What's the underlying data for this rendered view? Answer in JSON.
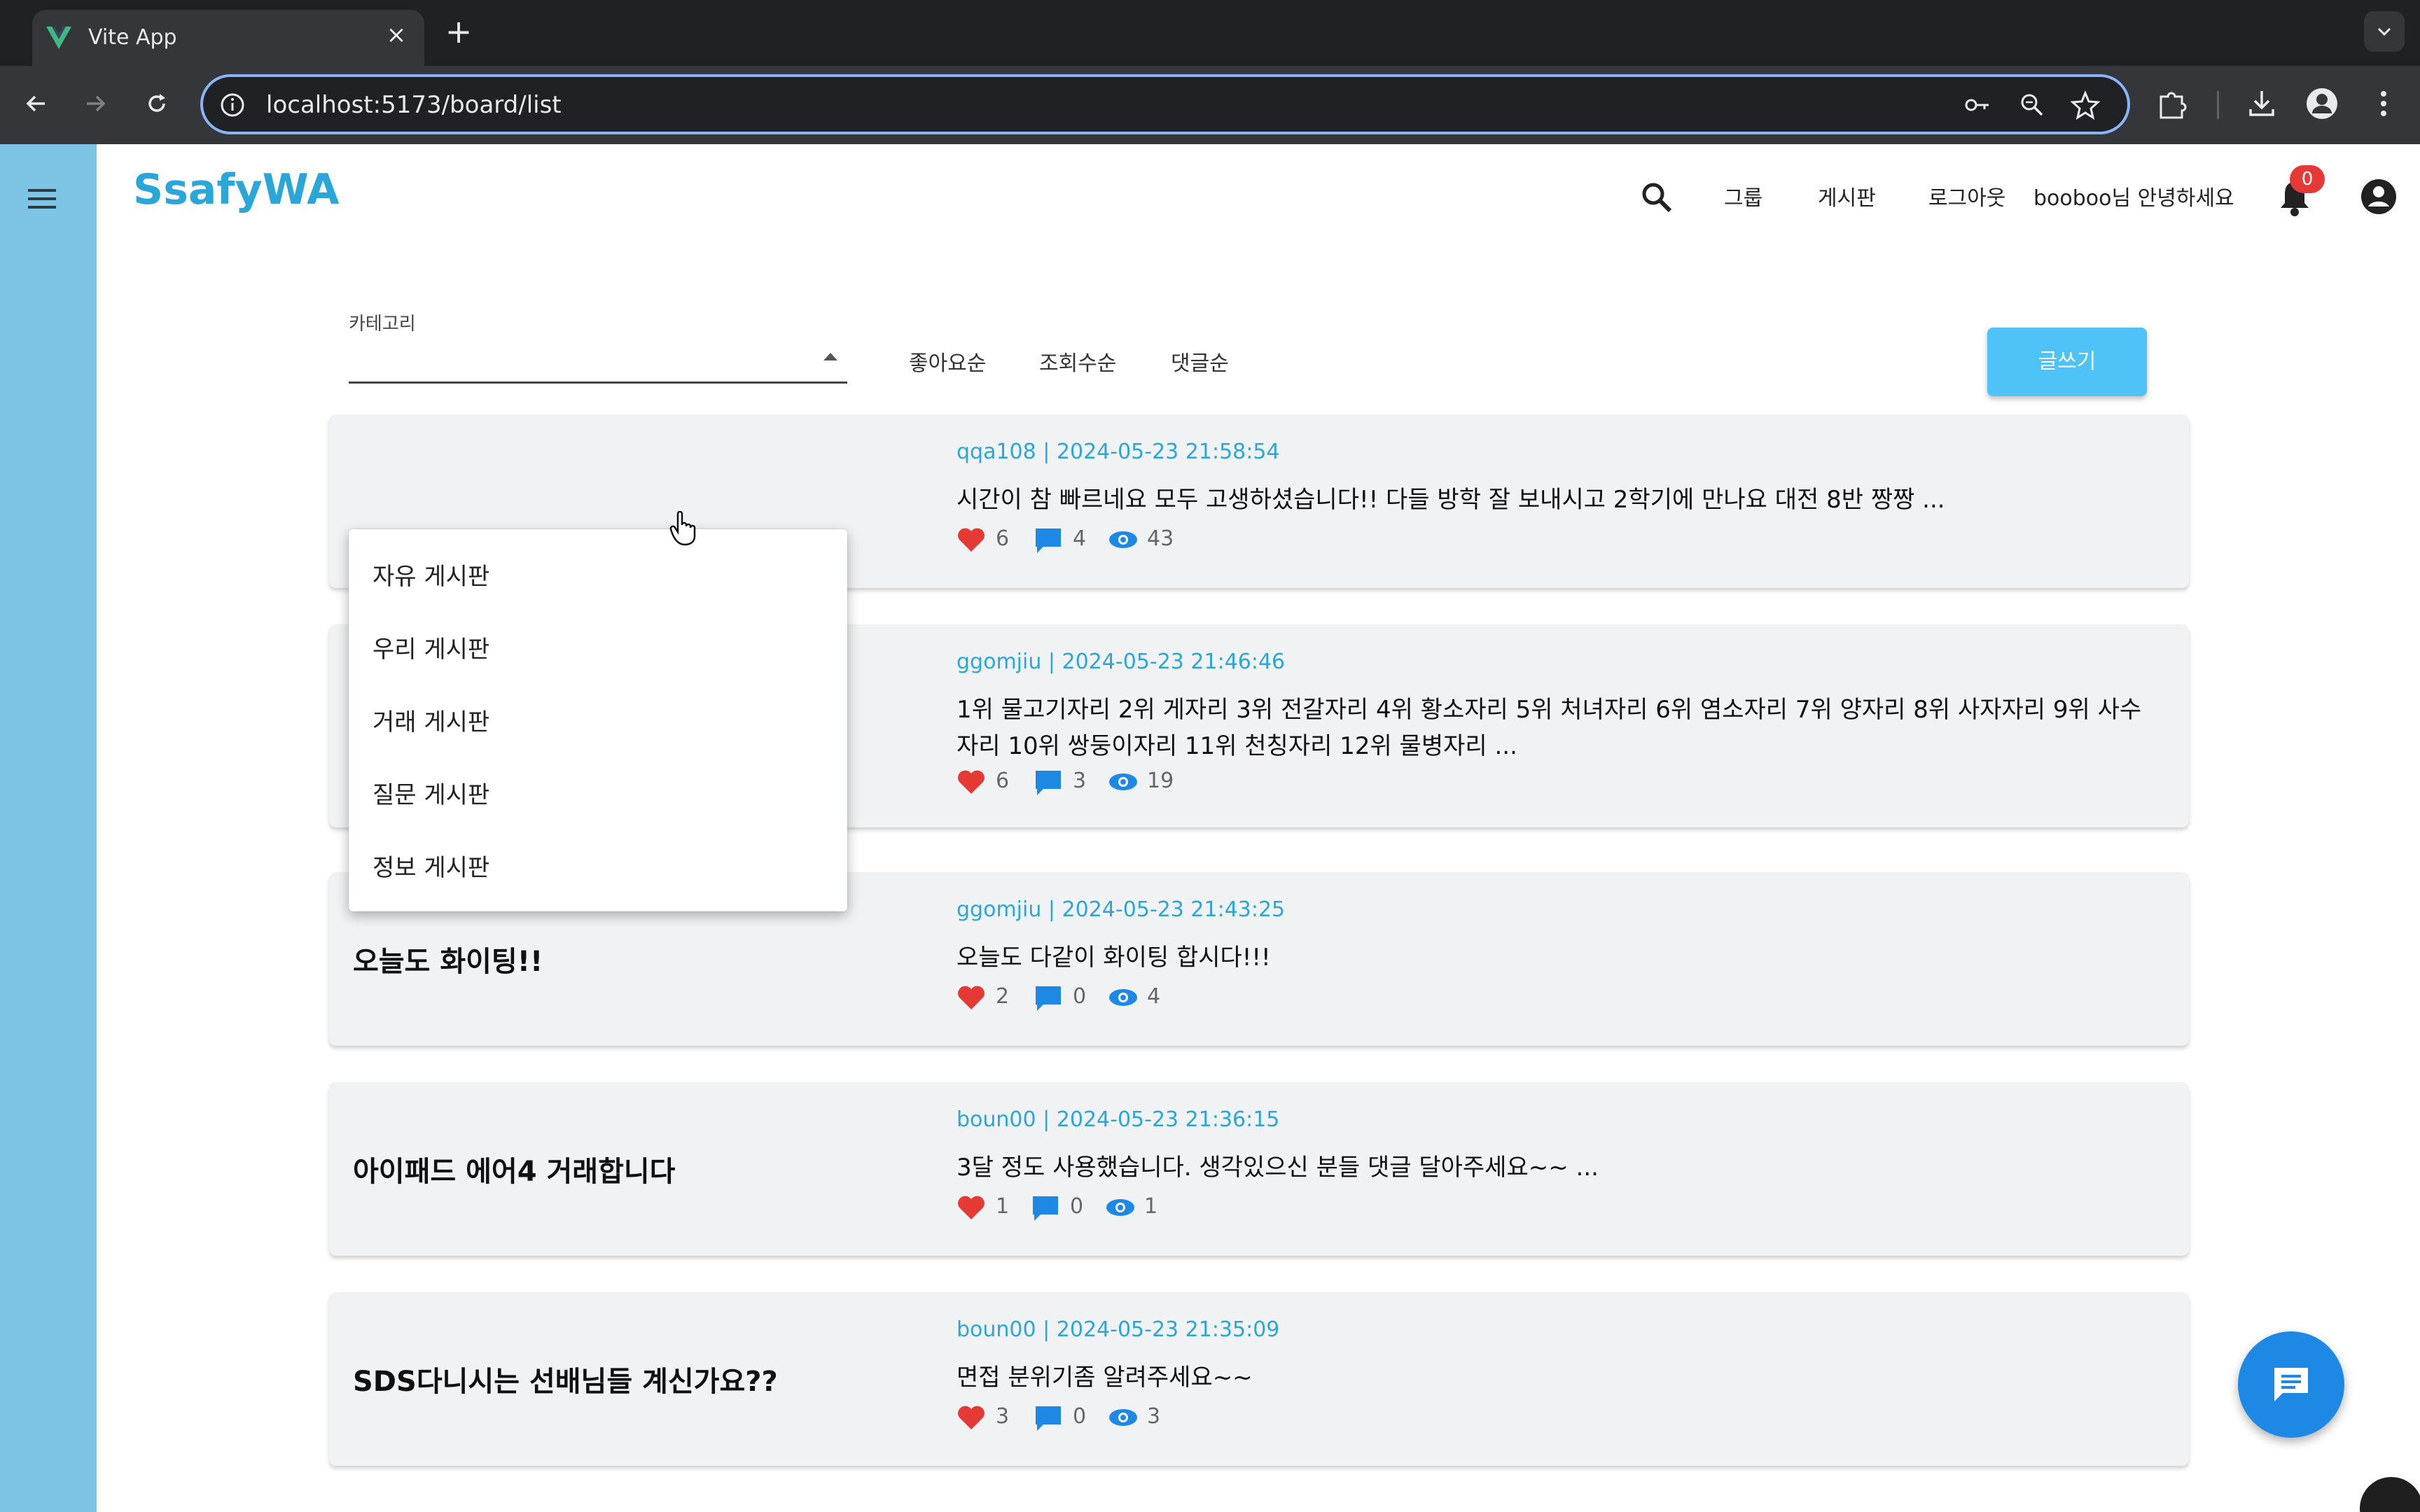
{
  "browser": {
    "tab_title": "Vite App",
    "url": "localhost:5173/board/list"
  },
  "app": {
    "brand": "SsafyWA",
    "nav": {
      "group": "그룹",
      "board": "게시판",
      "logout": "로그아웃",
      "greeting": "booboo님 안녕하세요",
      "notification_count": "0"
    },
    "filter": {
      "category_label": "카테고리",
      "sort_options": [
        "좋아요순",
        "조회수순",
        "댓글순"
      ],
      "write_button": "글쓰기"
    },
    "dropdown": {
      "options": [
        "자유 게시판",
        "우리 게시판",
        "거래 게시판",
        "질문 게시판",
        "정보 게시판"
      ]
    },
    "posts": [
      {
        "title": "",
        "meta": "qqa108 | 2024-05-23 21:58:54",
        "body": "시간이 참 빠르네요 모두 고생하셨습니다!! 다들 방학 잘 보내시고 2학기에 만나요 대전 8반 짱짱 ...",
        "likes": "6",
        "comments": "4",
        "views": "43"
      },
      {
        "title": "",
        "meta": "ggomjiu | 2024-05-23 21:46:46",
        "body": "1위 물고기자리 2위 게자리 3위 전갈자리 4위 황소자리 5위 처녀자리 6위 염소자리 7위 양자리 8위 사자자리 9위 사수자리 10위 쌍둥이자리 11위 천칭자리 12위 물병자리 ...",
        "likes": "6",
        "comments": "3",
        "views": "19"
      },
      {
        "title": "오늘도 화이팅!!",
        "meta": "ggomjiu | 2024-05-23 21:43:25",
        "body": "오늘도 다같이 화이팅 합시다!!!",
        "likes": "2",
        "comments": "0",
        "views": "4"
      },
      {
        "title": "아이패드 에어4 거래합니다",
        "meta": "boun00 | 2024-05-23 21:36:15",
        "body": "3달 정도 사용했습니다. 생각있으신 분들 댓글 달아주세요~~ ...",
        "likes": "1",
        "comments": "0",
        "views": "1"
      },
      {
        "title": "SDS다니시는 선배님들 계신가요??",
        "meta": "boun00 | 2024-05-23 21:35:09",
        "body": "면접 분위기좀 알려주세요~~",
        "likes": "3",
        "comments": "0",
        "views": "3"
      }
    ]
  },
  "colors": {
    "accent": "#2aa6d8",
    "side_rail": "#7cc3e4",
    "write_button": "#4fc3f7",
    "like_heart": "#e53935",
    "comment_icon": "#1e88e5",
    "view_icon": "#1e88e5",
    "fab": "#1e88e5"
  },
  "icons": {
    "tab_icon": "vue-logo-icon",
    "menu": "hamburger-menu-icon",
    "search": "search-icon",
    "notification": "bell-icon",
    "account": "account-circle-icon",
    "like": "heart-icon",
    "comment": "comment-icon",
    "view": "eye-icon",
    "chat": "chat-bubble-icon"
  }
}
